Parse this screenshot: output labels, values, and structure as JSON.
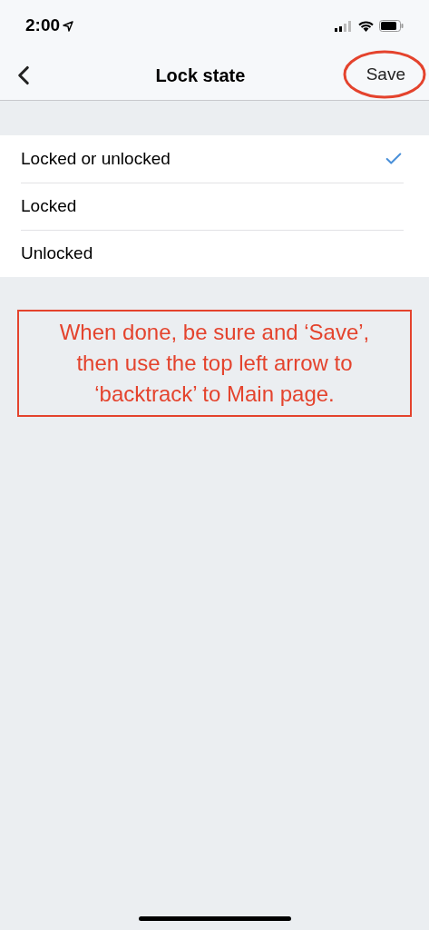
{
  "status_bar": {
    "time": "2:00"
  },
  "nav": {
    "title": "Lock state",
    "action": "Save",
    "action_circled": true
  },
  "options": [
    {
      "label": "Locked or unlocked",
      "selected": true
    },
    {
      "label": "Locked",
      "selected": false
    },
    {
      "label": "Unlocked",
      "selected": false
    }
  ],
  "annotation": {
    "text": "When done, be sure and ‘Save’, then use the top left arrow to ‘backtrack’ to Main page."
  }
}
